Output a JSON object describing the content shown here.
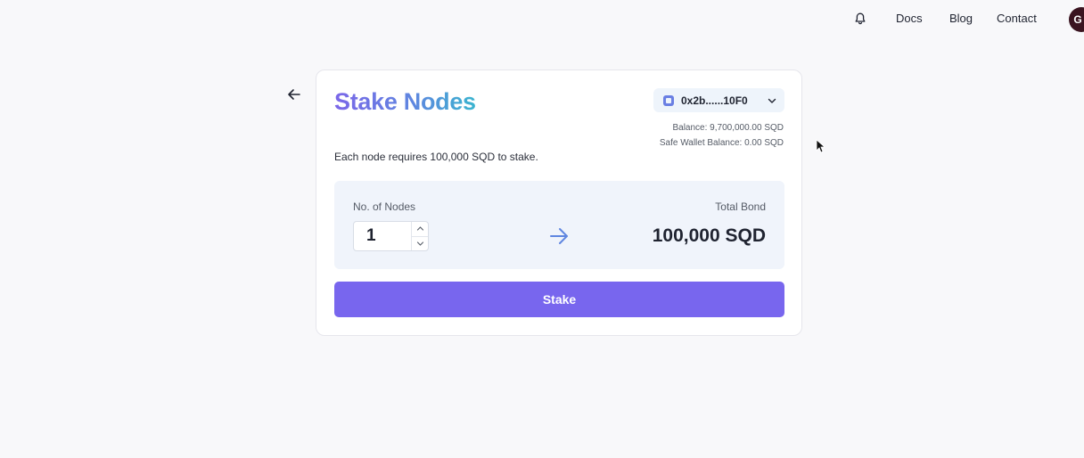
{
  "nav": {
    "notification_icon": "bell-icon",
    "links": [
      "Docs",
      "Blog",
      "Contact"
    ],
    "avatar_initial": "G"
  },
  "back_icon": "arrow-left-icon",
  "card": {
    "title": "Stake Nodes",
    "wallet": {
      "icon": "wallet-icon",
      "address": "0x2b......10F0",
      "dropdown_icon": "chevron-down-icon"
    },
    "balance": "Balance: 9,700,000.00 SQD",
    "safe_wallet_balance": "Safe Wallet Balance: 0.00 SQD",
    "requirement": "Each node requires 100,000 SQD to stake.",
    "nodes_label": "No. of Nodes",
    "nodes_value": "1",
    "total_bond_label": "Total Bond",
    "total_bond_value": "100,000 SQD",
    "stake_button": "Stake"
  },
  "colors": {
    "accent": "#7866ee",
    "title_gradient_start": "#7b67e8",
    "title_gradient_end": "#3ab4cf",
    "arrow": "#5f86e0"
  }
}
